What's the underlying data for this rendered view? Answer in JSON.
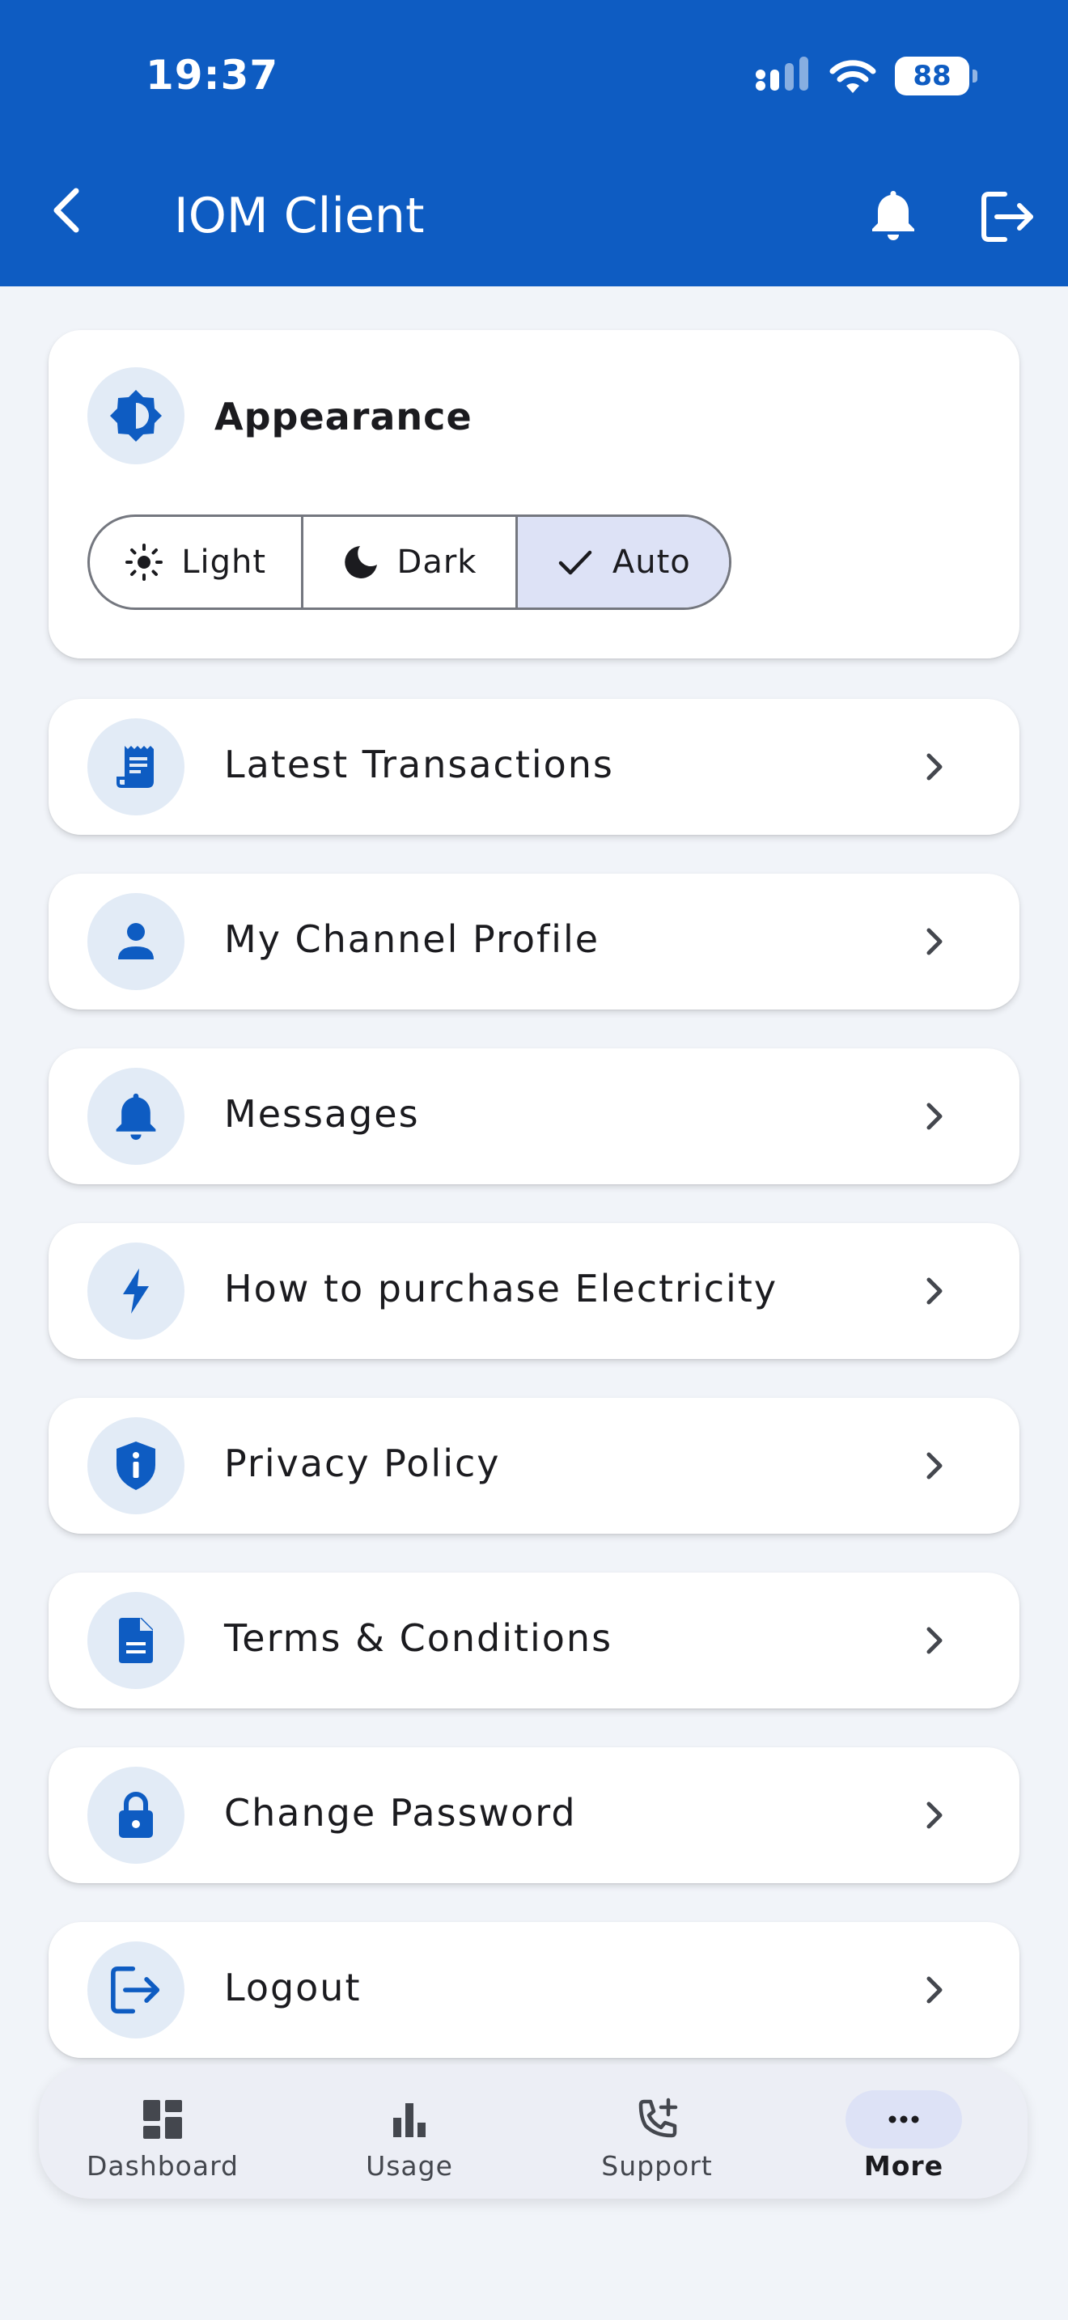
{
  "status_bar": {
    "time": "19:37",
    "battery": "88"
  },
  "app_bar": {
    "title": "IOM Client"
  },
  "appearance": {
    "title": "Appearance",
    "options": [
      {
        "label": "Light",
        "icon": "sun-icon"
      },
      {
        "label": "Dark",
        "icon": "moon-icon"
      },
      {
        "label": "Auto",
        "icon": "check-icon",
        "selected": true
      }
    ]
  },
  "menu": [
    {
      "label": "Latest Transactions",
      "icon": "receipt-icon"
    },
    {
      "label": "My Channel Profile",
      "icon": "person-icon"
    },
    {
      "label": "Messages",
      "icon": "bell-icon"
    },
    {
      "label": "How to purchase Electricity",
      "icon": "lightning-icon"
    },
    {
      "label": "Privacy Policy",
      "icon": "shield-info-icon"
    },
    {
      "label": "Terms & Conditions",
      "icon": "document-icon"
    },
    {
      "label": "Change Password",
      "icon": "lock-icon"
    },
    {
      "label": "Logout",
      "icon": "logout-icon"
    }
  ],
  "bottom_nav": [
    {
      "label": "Dashboard",
      "icon": "dashboard-icon"
    },
    {
      "label": "Usage",
      "icon": "bar-chart-icon"
    },
    {
      "label": "Support",
      "icon": "phone-add-icon"
    },
    {
      "label": "More",
      "icon": "more-icon",
      "active": true
    }
  ],
  "colors": {
    "primary": "#0e5cc2",
    "icon_bg": "#e2ebf6",
    "selected_bg": "#dde2f6",
    "background": "#f1f4f9"
  }
}
